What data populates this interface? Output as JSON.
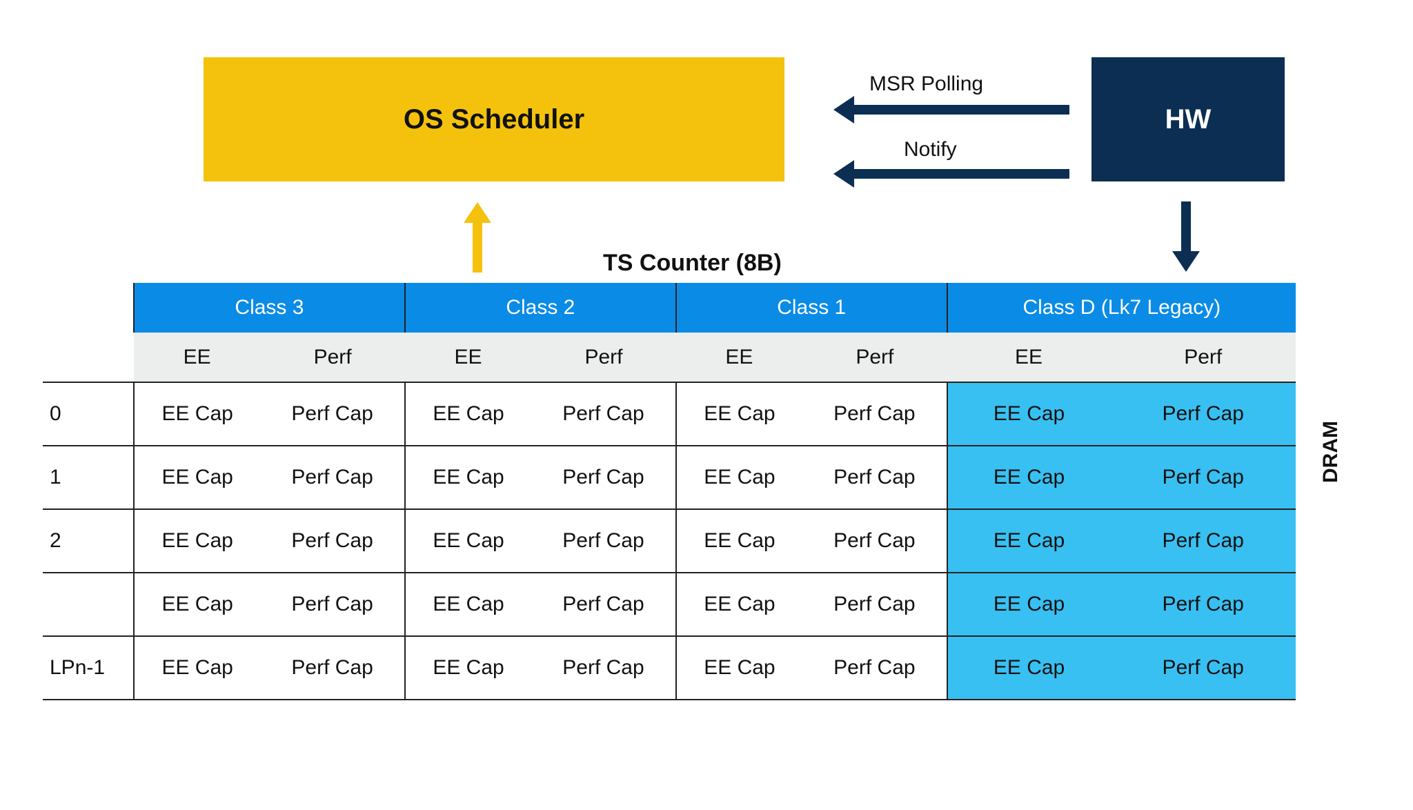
{
  "os_box": "OS Scheduler",
  "hw_box": "HW",
  "arrow_msr": "MSR Polling",
  "arrow_notify": "Notify",
  "ts_counter": "TS Counter (8B)",
  "dram": "DRAM",
  "classes": {
    "c3": "Class 3",
    "c2": "Class 2",
    "c1": "Class 1",
    "cd": "Class D (Lk7 Legacy)"
  },
  "sub": {
    "ee": "EE",
    "perf": "Perf"
  },
  "cell": {
    "ee": "EE Cap",
    "perf": "Perf Cap"
  },
  "rows": {
    "r0": "0",
    "r1": "1",
    "r2": "2",
    "r3": "",
    "r4": "LPn-1"
  },
  "colors": {
    "yellow": "#f4c20d",
    "navy": "#0c2e52",
    "blue_header": "#0a8be6",
    "legacy_cell": "#38c0f2",
    "sub_header": "#eceded"
  },
  "chart_data": {
    "type": "table",
    "title": "TS Counter (8B)",
    "columns": [
      {
        "class": "Class 3",
        "sub": [
          "EE",
          "Perf"
        ]
      },
      {
        "class": "Class 2",
        "sub": [
          "EE",
          "Perf"
        ]
      },
      {
        "class": "Class 1",
        "sub": [
          "EE",
          "Perf"
        ]
      },
      {
        "class": "Class D (Lk7 Legacy)",
        "sub": [
          "EE",
          "Perf"
        ],
        "highlight": true
      }
    ],
    "row_index": [
      "0",
      "1",
      "2",
      "",
      "LPn-1"
    ],
    "cell_values": {
      "ee": "EE Cap",
      "perf": "Perf Cap"
    },
    "side_label": "DRAM",
    "boxes": [
      "OS Scheduler",
      "HW"
    ],
    "arrows": [
      "MSR Polling",
      "Notify"
    ]
  }
}
